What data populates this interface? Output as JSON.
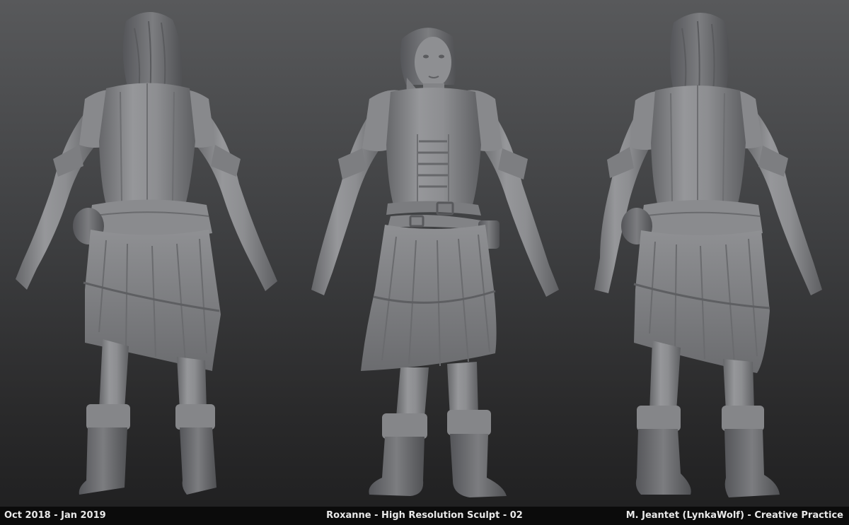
{
  "footer": {
    "date_range": "Oct 2018 - Jan 2019",
    "title": "Roxanne - High Resolution Sculpt - 02",
    "credit": "M. Jeantet (LynkaWolf) - Creative Practice"
  },
  "views": [
    {
      "name": "back"
    },
    {
      "name": "front"
    },
    {
      "name": "three-quarter-back"
    }
  ],
  "colors": {
    "background_top": "#58595b",
    "background_bottom": "#1f1f20",
    "clay": "#8e8f92",
    "footer_bar": "#0b0b0b",
    "footer_text": "#e9e9e9"
  }
}
